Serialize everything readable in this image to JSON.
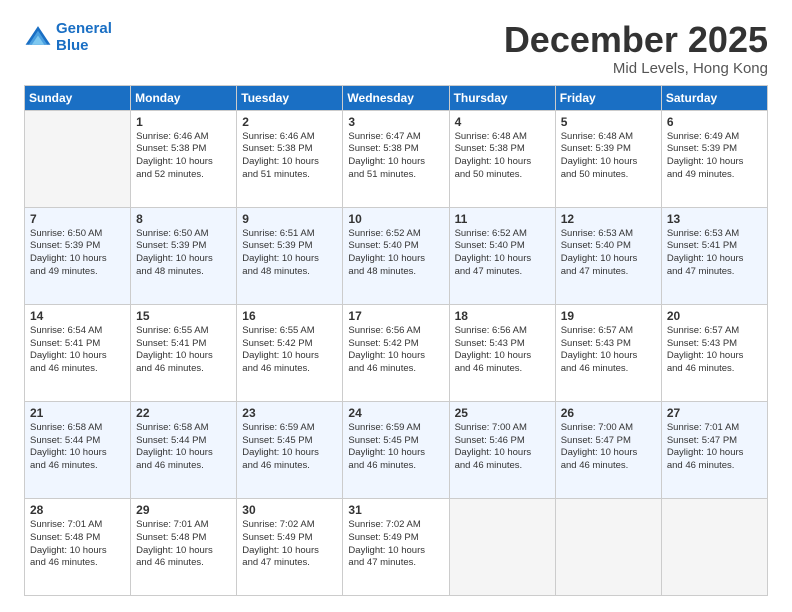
{
  "header": {
    "logo_line1": "General",
    "logo_line2": "Blue",
    "month": "December 2025",
    "location": "Mid Levels, Hong Kong"
  },
  "days": [
    "Sunday",
    "Monday",
    "Tuesday",
    "Wednesday",
    "Thursday",
    "Friday",
    "Saturday"
  ],
  "weeks": [
    [
      {
        "day": "",
        "info": ""
      },
      {
        "day": "1",
        "info": "Sunrise: 6:46 AM\nSunset: 5:38 PM\nDaylight: 10 hours\nand 52 minutes."
      },
      {
        "day": "2",
        "info": "Sunrise: 6:46 AM\nSunset: 5:38 PM\nDaylight: 10 hours\nand 51 minutes."
      },
      {
        "day": "3",
        "info": "Sunrise: 6:47 AM\nSunset: 5:38 PM\nDaylight: 10 hours\nand 51 minutes."
      },
      {
        "day": "4",
        "info": "Sunrise: 6:48 AM\nSunset: 5:38 PM\nDaylight: 10 hours\nand 50 minutes."
      },
      {
        "day": "5",
        "info": "Sunrise: 6:48 AM\nSunset: 5:39 PM\nDaylight: 10 hours\nand 50 minutes."
      },
      {
        "day": "6",
        "info": "Sunrise: 6:49 AM\nSunset: 5:39 PM\nDaylight: 10 hours\nand 49 minutes."
      }
    ],
    [
      {
        "day": "7",
        "info": "Sunrise: 6:50 AM\nSunset: 5:39 PM\nDaylight: 10 hours\nand 49 minutes."
      },
      {
        "day": "8",
        "info": "Sunrise: 6:50 AM\nSunset: 5:39 PM\nDaylight: 10 hours\nand 48 minutes."
      },
      {
        "day": "9",
        "info": "Sunrise: 6:51 AM\nSunset: 5:39 PM\nDaylight: 10 hours\nand 48 minutes."
      },
      {
        "day": "10",
        "info": "Sunrise: 6:52 AM\nSunset: 5:40 PM\nDaylight: 10 hours\nand 48 minutes."
      },
      {
        "day": "11",
        "info": "Sunrise: 6:52 AM\nSunset: 5:40 PM\nDaylight: 10 hours\nand 47 minutes."
      },
      {
        "day": "12",
        "info": "Sunrise: 6:53 AM\nSunset: 5:40 PM\nDaylight: 10 hours\nand 47 minutes."
      },
      {
        "day": "13",
        "info": "Sunrise: 6:53 AM\nSunset: 5:41 PM\nDaylight: 10 hours\nand 47 minutes."
      }
    ],
    [
      {
        "day": "14",
        "info": "Sunrise: 6:54 AM\nSunset: 5:41 PM\nDaylight: 10 hours\nand 46 minutes."
      },
      {
        "day": "15",
        "info": "Sunrise: 6:55 AM\nSunset: 5:41 PM\nDaylight: 10 hours\nand 46 minutes."
      },
      {
        "day": "16",
        "info": "Sunrise: 6:55 AM\nSunset: 5:42 PM\nDaylight: 10 hours\nand 46 minutes."
      },
      {
        "day": "17",
        "info": "Sunrise: 6:56 AM\nSunset: 5:42 PM\nDaylight: 10 hours\nand 46 minutes."
      },
      {
        "day": "18",
        "info": "Sunrise: 6:56 AM\nSunset: 5:43 PM\nDaylight: 10 hours\nand 46 minutes."
      },
      {
        "day": "19",
        "info": "Sunrise: 6:57 AM\nSunset: 5:43 PM\nDaylight: 10 hours\nand 46 minutes."
      },
      {
        "day": "20",
        "info": "Sunrise: 6:57 AM\nSunset: 5:43 PM\nDaylight: 10 hours\nand 46 minutes."
      }
    ],
    [
      {
        "day": "21",
        "info": "Sunrise: 6:58 AM\nSunset: 5:44 PM\nDaylight: 10 hours\nand 46 minutes."
      },
      {
        "day": "22",
        "info": "Sunrise: 6:58 AM\nSunset: 5:44 PM\nDaylight: 10 hours\nand 46 minutes."
      },
      {
        "day": "23",
        "info": "Sunrise: 6:59 AM\nSunset: 5:45 PM\nDaylight: 10 hours\nand 46 minutes."
      },
      {
        "day": "24",
        "info": "Sunrise: 6:59 AM\nSunset: 5:45 PM\nDaylight: 10 hours\nand 46 minutes."
      },
      {
        "day": "25",
        "info": "Sunrise: 7:00 AM\nSunset: 5:46 PM\nDaylight: 10 hours\nand 46 minutes."
      },
      {
        "day": "26",
        "info": "Sunrise: 7:00 AM\nSunset: 5:47 PM\nDaylight: 10 hours\nand 46 minutes."
      },
      {
        "day": "27",
        "info": "Sunrise: 7:01 AM\nSunset: 5:47 PM\nDaylight: 10 hours\nand 46 minutes."
      }
    ],
    [
      {
        "day": "28",
        "info": "Sunrise: 7:01 AM\nSunset: 5:48 PM\nDaylight: 10 hours\nand 46 minutes."
      },
      {
        "day": "29",
        "info": "Sunrise: 7:01 AM\nSunset: 5:48 PM\nDaylight: 10 hours\nand 46 minutes."
      },
      {
        "day": "30",
        "info": "Sunrise: 7:02 AM\nSunset: 5:49 PM\nDaylight: 10 hours\nand 47 minutes."
      },
      {
        "day": "31",
        "info": "Sunrise: 7:02 AM\nSunset: 5:49 PM\nDaylight: 10 hours\nand 47 minutes."
      },
      {
        "day": "",
        "info": ""
      },
      {
        "day": "",
        "info": ""
      },
      {
        "day": "",
        "info": ""
      }
    ]
  ]
}
